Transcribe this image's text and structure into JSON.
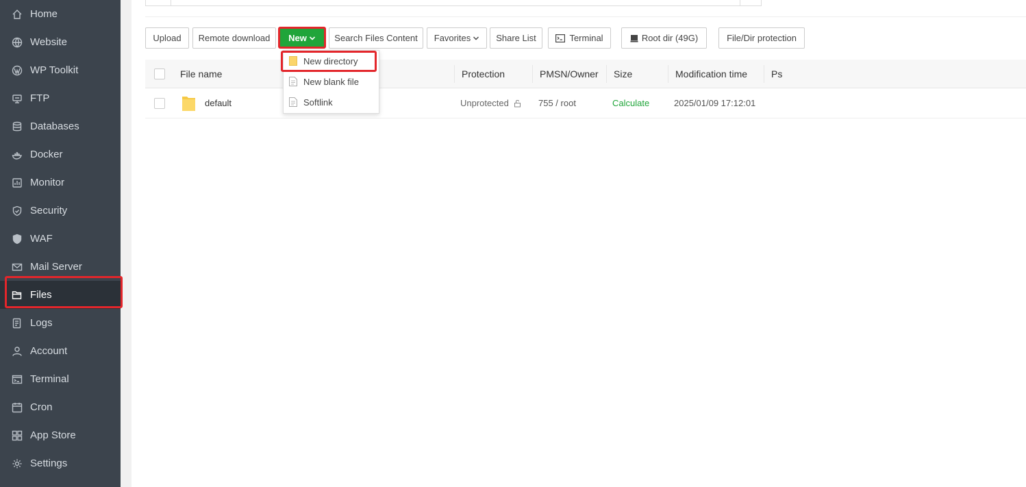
{
  "sidebar": {
    "items": [
      {
        "label": "Home",
        "icon": "home-icon"
      },
      {
        "label": "Website",
        "icon": "globe-icon"
      },
      {
        "label": "WP Toolkit",
        "icon": "wordpress-icon"
      },
      {
        "label": "FTP",
        "icon": "ftp-icon"
      },
      {
        "label": "Databases",
        "icon": "database-icon"
      },
      {
        "label": "Docker",
        "icon": "docker-icon"
      },
      {
        "label": "Monitor",
        "icon": "monitor-icon"
      },
      {
        "label": "Security",
        "icon": "shield-icon"
      },
      {
        "label": "WAF",
        "icon": "waf-shield-icon"
      },
      {
        "label": "Mail Server",
        "icon": "mail-icon"
      },
      {
        "label": "Files",
        "icon": "folder-icon",
        "active": true
      },
      {
        "label": "Logs",
        "icon": "logs-icon"
      },
      {
        "label": "Account",
        "icon": "user-icon"
      },
      {
        "label": "Terminal",
        "icon": "terminal-icon"
      },
      {
        "label": "Cron",
        "icon": "clock-icon"
      },
      {
        "label": "App Store",
        "icon": "grid-icon"
      },
      {
        "label": "Settings",
        "icon": "gear-icon"
      }
    ]
  },
  "toolbar": {
    "upload": "Upload",
    "remote_download": "Remote download",
    "new": "New",
    "search_files_content": "Search Files Content",
    "favorites": "Favorites",
    "share_list": "Share List",
    "terminal": "Terminal",
    "root_dir": "Root dir (49G)",
    "file_dir_protection": "File/Dir protection"
  },
  "new_menu": {
    "items": [
      "New directory",
      "New blank file",
      "Softlink"
    ]
  },
  "table": {
    "headers": {
      "file_name": "File name",
      "protection": "Protection",
      "pmsn_owner": "PMSN/Owner",
      "size": "Size",
      "modification_time": "Modification time",
      "ps": "Ps"
    },
    "rows": [
      {
        "name": "default",
        "protection": "Unprotected",
        "pmsn_owner": "755 / root",
        "size": "Calculate",
        "modified": "2025/01/09 17:12:01"
      }
    ]
  },
  "colors": {
    "sidebar_bg": "#3c444d",
    "accent_green": "#20a53a",
    "highlight_red": "#e3262b"
  }
}
